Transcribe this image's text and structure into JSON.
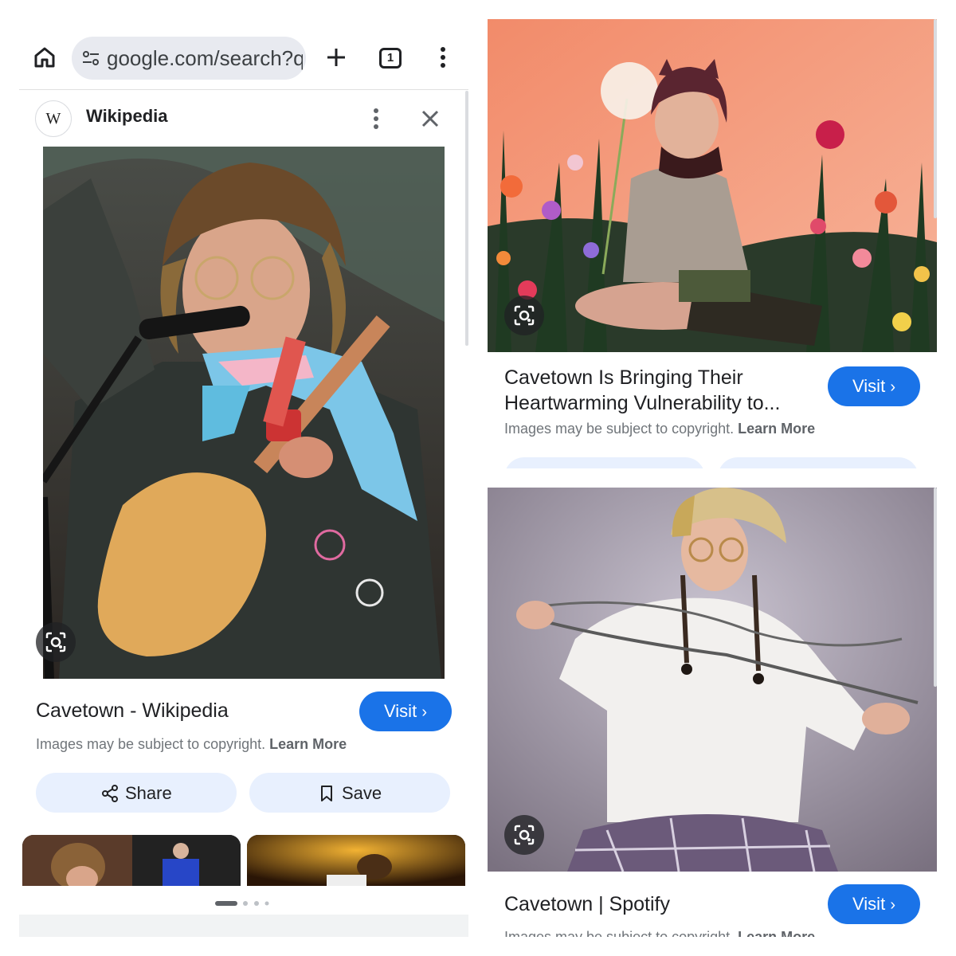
{
  "browser": {
    "url": "google.com/search?q",
    "tab_count": "1"
  },
  "left_result": {
    "source": "Wikipedia",
    "title": "Cavetown - Wikipedia",
    "visit_label": "Visit",
    "copyright_text": "Images may be subject to copyright.",
    "learn_more": "Learn More",
    "share_label": "Share",
    "save_label": "Save"
  },
  "right_top_result": {
    "title_line1": "Cavetown Is Bringing Their",
    "title_line2": "Heartwarming Vulnerability to...",
    "visit_label": "Visit",
    "copyright_text": "Images may be subject to copyright.",
    "learn_more": "Learn More"
  },
  "right_bottom_result": {
    "title": "Cavetown | Spotify",
    "visit_label": "Visit",
    "copyright_text": "Images may be subject to copyright.",
    "learn_more": "Learn More"
  },
  "colors": {
    "accent": "#1a73e8",
    "chip_bg": "#e8f0fe",
    "url_bg": "#e8eaf0"
  },
  "icons": [
    "home-icon",
    "tune-icon",
    "plus-icon",
    "tabs-icon",
    "more-vert-icon",
    "wiki-logo",
    "close-icon",
    "lens-icon",
    "chevron-right-icon",
    "share-icon",
    "bookmark-icon"
  ]
}
